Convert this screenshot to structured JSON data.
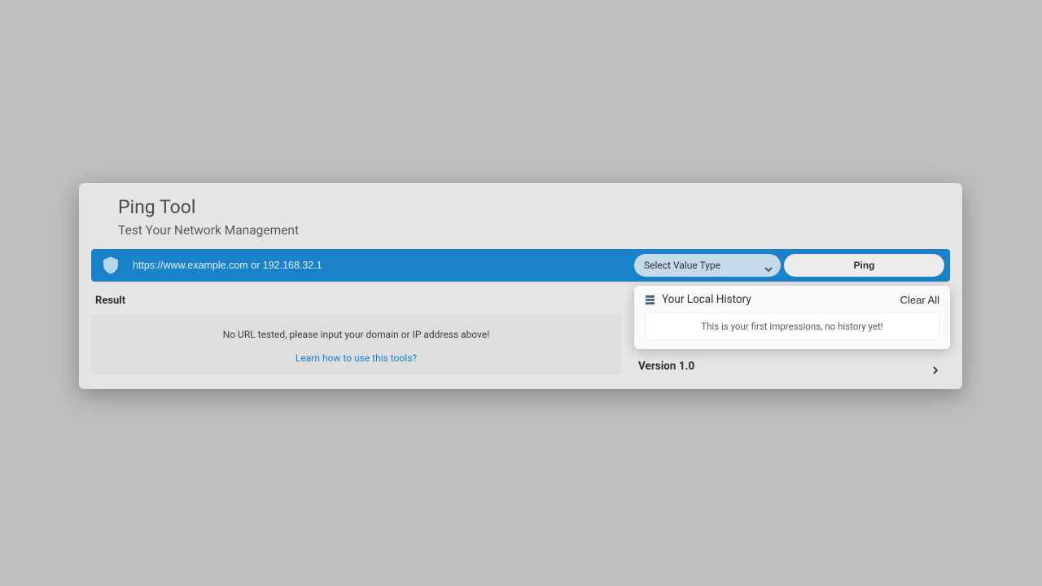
{
  "header": {
    "title": "Ping Tool",
    "subtitle": "Test Your Network Management"
  },
  "search": {
    "placeholder": "https://www.example.com or 192.168.32.1",
    "value": "",
    "select_label": "Select Value Type",
    "button_label": "Ping"
  },
  "result": {
    "section_label": "Result",
    "empty_text": "No URL tested, please input your domain or IP address above!",
    "learn_link": "Learn how to use this tools?"
  },
  "history": {
    "title": "Your Local History",
    "clear_label": "Clear All",
    "empty_text": "This is your first impressions, no history yet!"
  },
  "footer": {
    "version_label": "Version 1.0"
  },
  "colors": {
    "accent": "#1a82c9"
  }
}
